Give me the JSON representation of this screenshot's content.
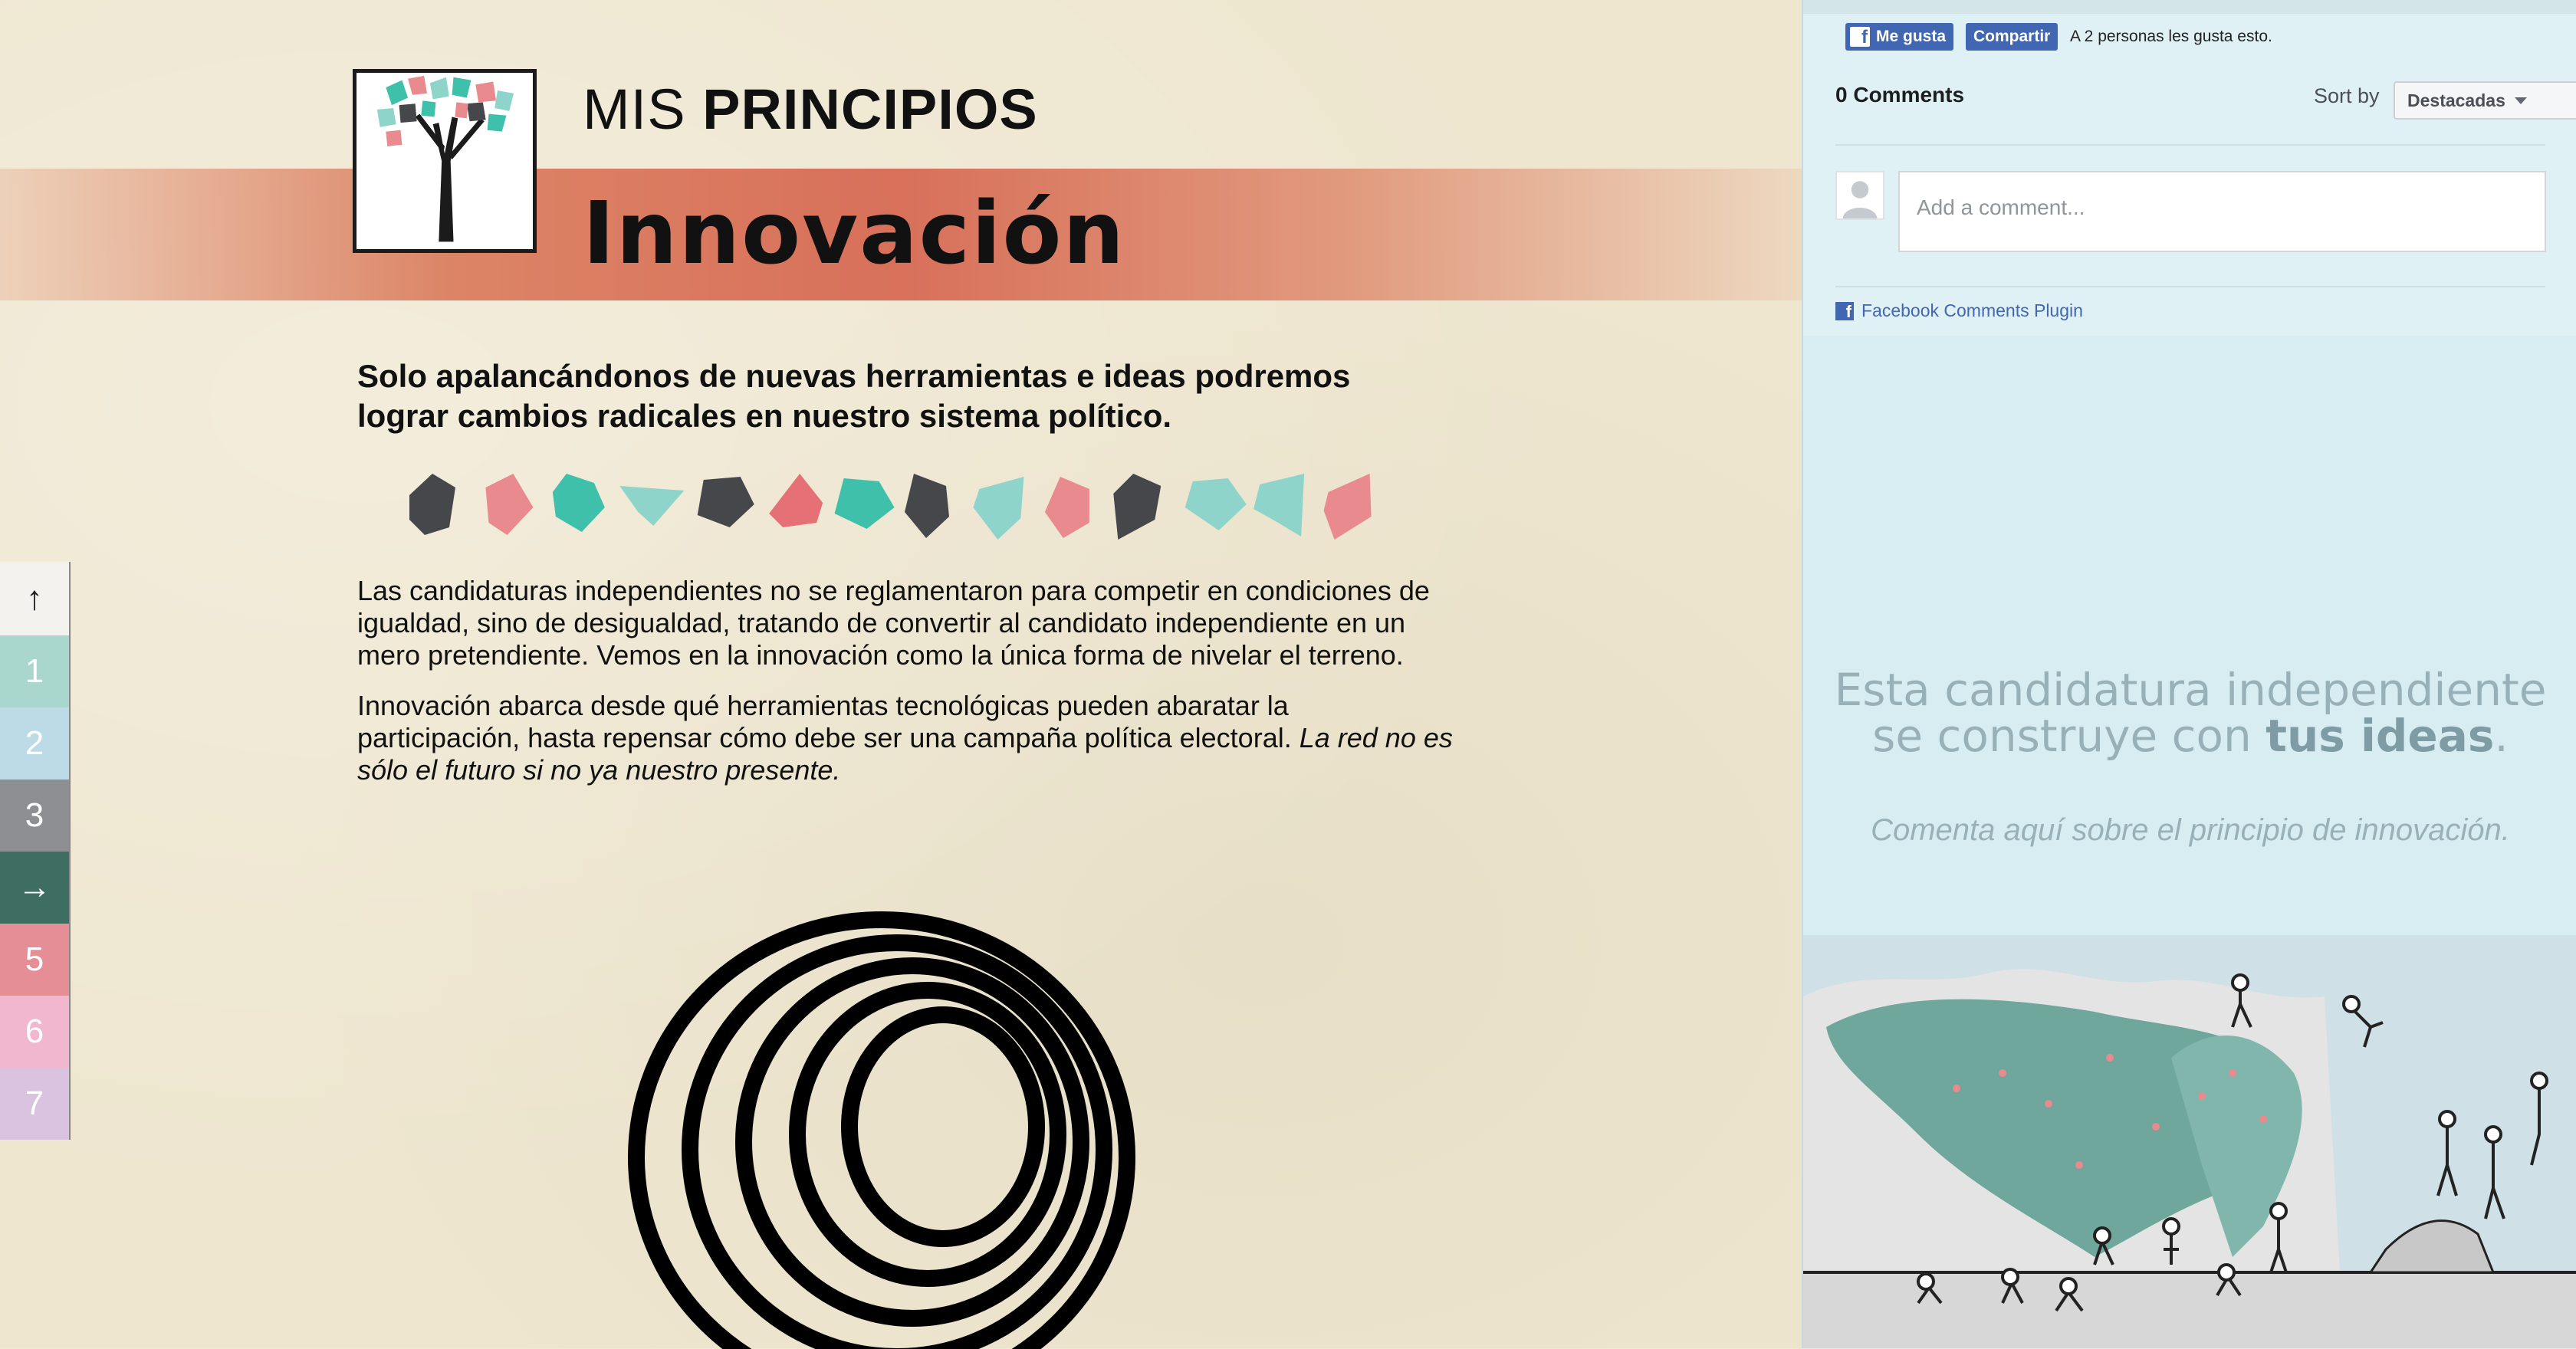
{
  "header": {
    "kicker_light": "MIS",
    "kicker_bold": "PRINCIPIOS",
    "title": "Innovación"
  },
  "content": {
    "lead": "Solo apalancándonos de nuevas herramientas e ideas podremos lograr cambios radicales en nuestro sistema político.",
    "paragraph1": "Las candidaturas independientes no se reglamentaron para competir en condiciones de igualdad, sino de desigualdad, tratando de convertir al candidato independiente en un mero pretendiente. Vemos en la innovación como la única forma de nivelar el terreno.",
    "paragraph2_text": "Innovación abarca desde qué herramientas tecnológicas pueden abaratar la participación, hasta repensar cómo debe ser una campaña política electoral. ",
    "paragraph2_italic": "La red no es sólo el futuro si no ya nuestro presente."
  },
  "gem_colors": [
    "#45474b",
    "#e98a8e",
    "#3fc0aa",
    "#8fd4cb",
    "#45474b",
    "#e57076",
    "#3fc0aa",
    "#45474b",
    "#8fd4cb",
    "#e98a8e",
    "#45474b",
    "#8fd4cb",
    "#8fd4cb",
    "#e98a8e"
  ],
  "sidenav": {
    "up_label": "↑",
    "items": [
      "1",
      "2",
      "3",
      "→",
      "5",
      "6",
      "7"
    ],
    "colors": [
      "#a9d6cd",
      "#bcdbe7",
      "#8e8f92",
      "#3e6e62",
      "#e58e96",
      "#f0b7cf",
      "#d9c3e0"
    ]
  },
  "facebook": {
    "like_label": "Me gusta",
    "share_label": "Compartir",
    "like_summary": "A 2 personas les gusta esto.",
    "comments_count": "0 Comments",
    "sort_label": "Sort by",
    "sort_value": "Destacadas",
    "comment_placeholder": "Add a comment...",
    "plugin_label": "Facebook Comments Plugin",
    "brand_color": "#4267b2"
  },
  "cta": {
    "line1": "Esta candidatura independiente",
    "line2_prefix": "se construye con ",
    "line2_bold": "tus ideas",
    "line2_suffix": ".",
    "sub": "Comenta aquí sobre el principio de innovación."
  }
}
